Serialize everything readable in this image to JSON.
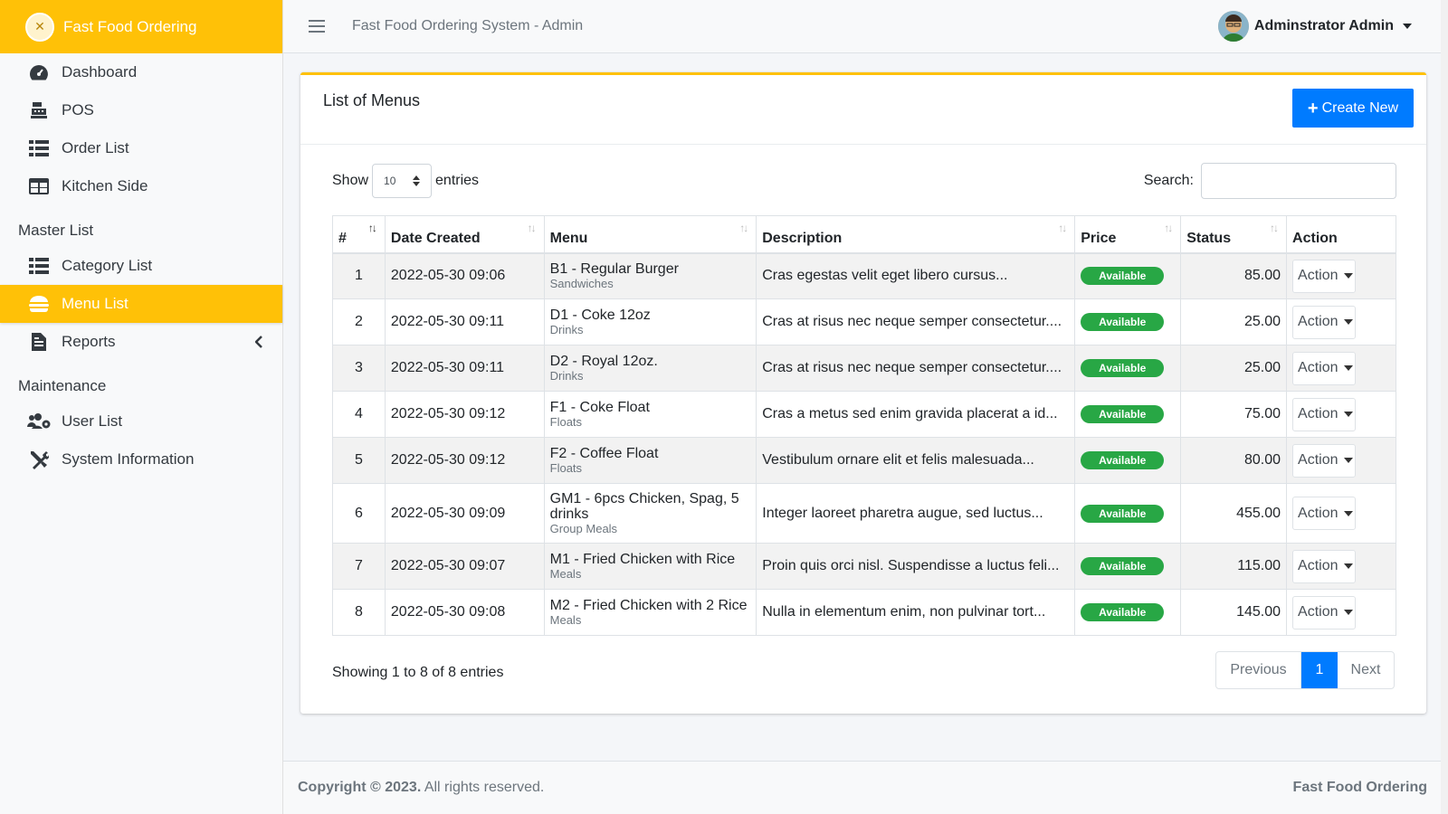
{
  "brand": {
    "name": "Fast Food Ordering"
  },
  "sidebar": {
    "items": [
      {
        "label": "Dashboard"
      },
      {
        "label": "POS"
      },
      {
        "label": "Order List"
      },
      {
        "label": "Kitchen Side"
      }
    ],
    "master_header": "Master List",
    "master_items": [
      {
        "label": "Category List"
      },
      {
        "label": "Menu List"
      },
      {
        "label": "Reports"
      }
    ],
    "maintenance_header": "Maintenance",
    "maintenance_items": [
      {
        "label": "User List"
      },
      {
        "label": "System Information"
      }
    ]
  },
  "topbar": {
    "title": "Fast Food Ordering System - Admin",
    "user": "Adminstrator Admin"
  },
  "card": {
    "title": "List of Menus",
    "create_label": "Create New"
  },
  "controls": {
    "show_label": "Show",
    "entries_value": "10",
    "entries_label": "entries",
    "search_label": "Search:",
    "search_value": ""
  },
  "table": {
    "headers": [
      "#",
      "Date Created",
      "Menu",
      "Description",
      "Price",
      "Status",
      "Action"
    ],
    "rows": [
      {
        "num": "1",
        "date": "2022-05-30 09:06",
        "menu": "B1 - Regular Burger",
        "cat": "Sandwiches",
        "desc": "Cras egestas velit eget libero cursus...",
        "status": "Available",
        "price": "85.00",
        "action": "Action"
      },
      {
        "num": "2",
        "date": "2022-05-30 09:11",
        "menu": "D1 - Coke 12oz",
        "cat": "Drinks",
        "desc": "Cras at risus nec neque semper consectetur....",
        "status": "Available",
        "price": "25.00",
        "action": "Action"
      },
      {
        "num": "3",
        "date": "2022-05-30 09:11",
        "menu": "D2 - Royal 12oz.",
        "cat": "Drinks",
        "desc": "Cras at risus nec neque semper consectetur....",
        "status": "Available",
        "price": "25.00",
        "action": "Action"
      },
      {
        "num": "4",
        "date": "2022-05-30 09:12",
        "menu": "F1 - Coke Float",
        "cat": "Floats",
        "desc": "Cras a metus sed enim gravida placerat a id...",
        "status": "Available",
        "price": "75.00",
        "action": "Action"
      },
      {
        "num": "5",
        "date": "2022-05-30 09:12",
        "menu": "F2 - Coffee Float",
        "cat": "Floats",
        "desc": "Vestibulum ornare elit et felis malesuada...",
        "status": "Available",
        "price": "80.00",
        "action": "Action"
      },
      {
        "num": "6",
        "date": "2022-05-30 09:09",
        "menu": "GM1 - 6pcs Chicken, Spag, 5 drinks",
        "cat": "Group Meals",
        "desc": "Integer laoreet pharetra augue, sed luctus...",
        "status": "Available",
        "price": "455.00",
        "action": "Action"
      },
      {
        "num": "7",
        "date": "2022-05-30 09:07",
        "menu": "M1 - Fried Chicken with Rice",
        "cat": "Meals",
        "desc": "Proin quis orci nisl. Suspendisse a luctus feli...",
        "status": "Available",
        "price": "115.00",
        "action": "Action"
      },
      {
        "num": "8",
        "date": "2022-05-30 09:08",
        "menu": "M2 - Fried Chicken with 2 Rice",
        "cat": "Meals",
        "desc": "Nulla in elementum enim, non pulvinar tort...",
        "status": "Available",
        "price": "145.00",
        "action": "Action"
      }
    ]
  },
  "pagination": {
    "info": "Showing 1 to 8 of 8 entries",
    "prev": "Previous",
    "current": "1",
    "next": "Next"
  },
  "footer": {
    "copyright_bold": "Copyright © 2023.",
    "copyright_rest": " All rights reserved.",
    "right": "Fast Food Ordering"
  },
  "colors": {
    "accent": "#ffc107",
    "primary": "#007bff",
    "success": "#28a745"
  }
}
